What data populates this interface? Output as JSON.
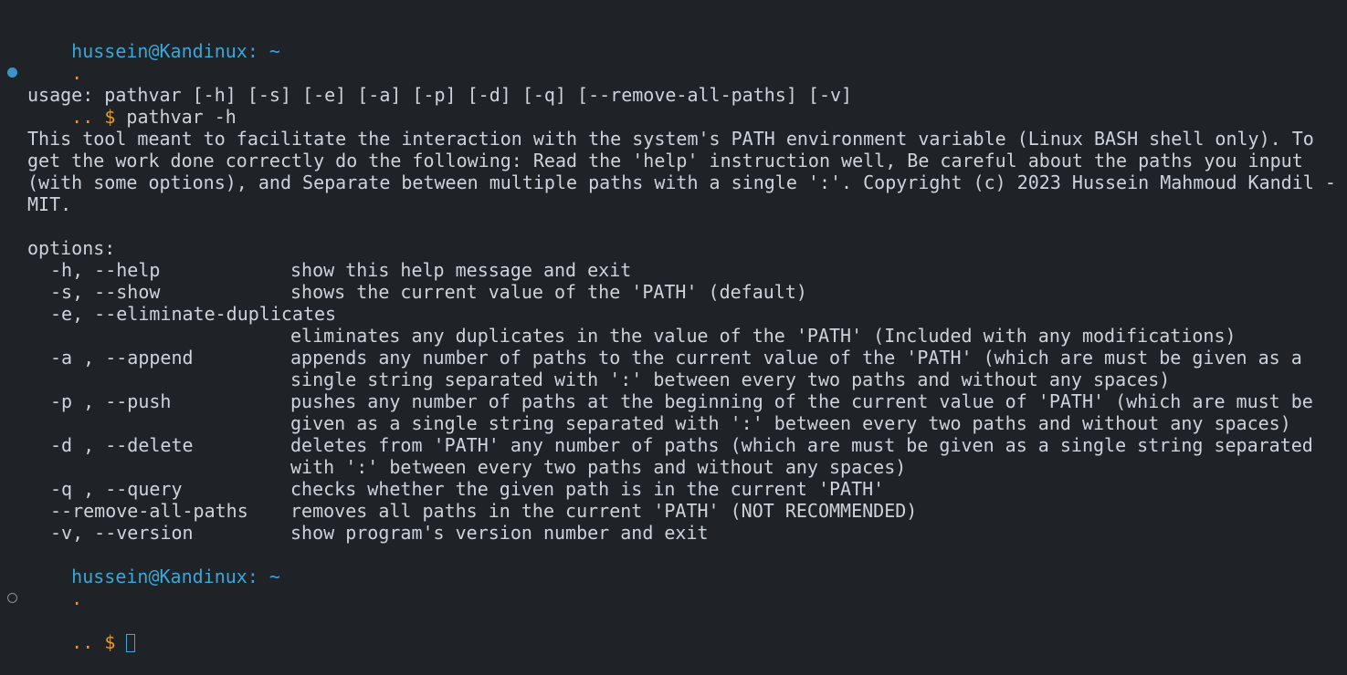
{
  "session": {
    "user_host": "hussein@Kandinux:",
    "cwd": "~",
    "dir_marker": ".",
    "prompt_dots": "..",
    "prompt_symbol": "$",
    "command": "pathvar -h"
  },
  "help": {
    "usage": "usage: pathvar [-h] [-s] [-e] [-a] [-p] [-d] [-q] [--remove-all-paths] [-v]",
    "description_lines": [
      "This tool meant to facilitate the interaction with the system's PATH environment variable (Linux BASH shell only). To",
      "get the work done correctly do the following: Read the 'help' instruction well, Be careful about the paths you input",
      "(with some options), and Separate between multiple paths with a single ':'. Copyright (c) 2023 Hussein Mahmoud Kandil -",
      "MIT."
    ],
    "options_heading": "options:",
    "options": [
      {
        "flag": "-h, --help",
        "desc": [
          "show this help message and exit"
        ]
      },
      {
        "flag": "-s, --show",
        "desc": [
          "shows the current value of the 'PATH' (default)"
        ]
      },
      {
        "flag": "-e, --eliminate-duplicates",
        "desc": [
          "eliminates any duplicates in the value of the 'PATH' (Included with any modifications)"
        ]
      },
      {
        "flag": "-a , --append",
        "desc": [
          "appends any number of paths to the current value of the 'PATH' (which are must be given as a",
          "single string separated with ':' between every two paths and without any spaces)"
        ]
      },
      {
        "flag": "-p , --push",
        "desc": [
          "pushes any number of paths at the beginning of the current value of 'PATH' (which are must be",
          "given as a single string separated with ':' between every two paths and without any spaces)"
        ]
      },
      {
        "flag": "-d , --delete",
        "desc": [
          "deletes from 'PATH' any number of paths (which are must be given as a single string separated",
          "with ':' between every two paths and without any spaces)"
        ]
      },
      {
        "flag": "-q , --query",
        "desc": [
          "checks whether the given path is in the current 'PATH'"
        ]
      },
      {
        "flag": "--remove-all-paths",
        "desc": [
          "removes all paths in the current 'PATH' (NOT RECOMMENDED)"
        ]
      },
      {
        "flag": "-v, --version",
        "desc": [
          "show program's version number and exit"
        ]
      }
    ]
  },
  "colors": {
    "background": "#1f2328",
    "user_host": "#3aa7d8",
    "prompt": "#e59a2e",
    "text": "#cdd3da"
  }
}
